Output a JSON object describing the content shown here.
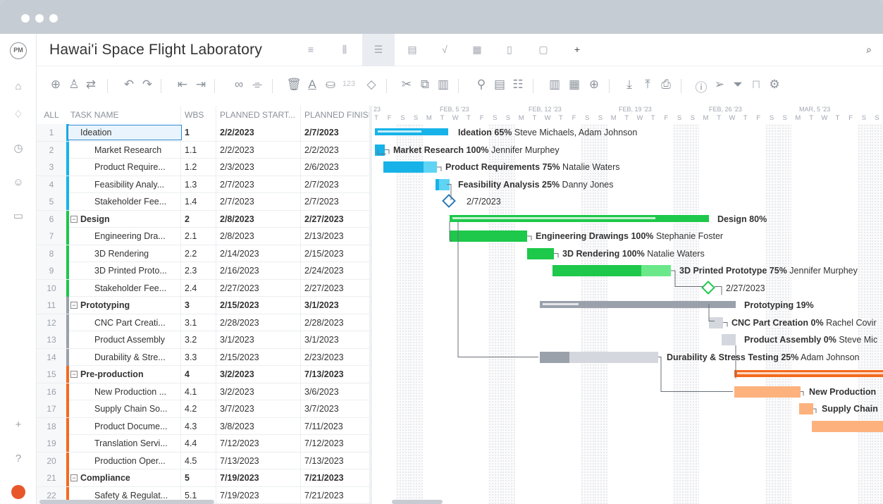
{
  "app": {
    "title": "Hawai'i Space Flight Laboratory",
    "logo_text": "PM"
  },
  "columns": {
    "all": "ALL",
    "task": "TASK NAME",
    "wbs": "WBS",
    "start": "PLANNED START...",
    "finish": "PLANNED FINISI"
  },
  "timeline": {
    "months": [
      "FEB, 5 '23",
      "FEB, 12 '23",
      "FEB, 19 '23",
      "FEB, 26 '23",
      "MAR, 5 '23"
    ],
    "first_month_fragment": "23",
    "days": [
      "T",
      "F",
      "S",
      "S",
      "M",
      "T",
      "W",
      "T",
      "F",
      "S",
      "S",
      "M",
      "T",
      "W",
      "T",
      "F",
      "S",
      "S",
      "M",
      "T",
      "W",
      "T",
      "F",
      "S",
      "S",
      "M",
      "T",
      "W",
      "T",
      "F",
      "S",
      "S",
      "M",
      "T",
      "W",
      "T",
      "F",
      "S",
      "S"
    ]
  },
  "rows": [
    {
      "num": "1",
      "name": "Ideation",
      "wbs": "1",
      "start": "2/2/2023",
      "finish": "2/7/2023",
      "type": "summary-plain",
      "color": "#17b3e8"
    },
    {
      "num": "2",
      "name": "Market Research",
      "wbs": "1.1",
      "start": "2/2/2023",
      "finish": "2/2/2023",
      "type": "task",
      "color": "#17b3e8"
    },
    {
      "num": "3",
      "name": "Product Require...",
      "wbs": "1.2",
      "start": "2/3/2023",
      "finish": "2/6/2023",
      "type": "task",
      "color": "#17b3e8"
    },
    {
      "num": "4",
      "name": "Feasibility Analy...",
      "wbs": "1.3",
      "start": "2/7/2023",
      "finish": "2/7/2023",
      "type": "task",
      "color": "#17b3e8"
    },
    {
      "num": "5",
      "name": "Stakeholder Fee...",
      "wbs": "1.4",
      "start": "2/7/2023",
      "finish": "2/7/2023",
      "type": "task",
      "color": "#17b3e8"
    },
    {
      "num": "6",
      "name": "Design",
      "wbs": "2",
      "start": "2/8/2023",
      "finish": "2/27/2023",
      "type": "summary",
      "color": "#1dc84a"
    },
    {
      "num": "7",
      "name": "Engineering Dra...",
      "wbs": "2.1",
      "start": "2/8/2023",
      "finish": "2/13/2023",
      "type": "task",
      "color": "#1dc84a"
    },
    {
      "num": "8",
      "name": "3D Rendering",
      "wbs": "2.2",
      "start": "2/14/2023",
      "finish": "2/15/2023",
      "type": "task",
      "color": "#1dc84a"
    },
    {
      "num": "9",
      "name": "3D Printed Proto...",
      "wbs": "2.3",
      "start": "2/16/2023",
      "finish": "2/24/2023",
      "type": "task",
      "color": "#1dc84a"
    },
    {
      "num": "10",
      "name": "Stakeholder Fee...",
      "wbs": "2.4",
      "start": "2/27/2023",
      "finish": "2/27/2023",
      "type": "task",
      "color": "#1dc84a"
    },
    {
      "num": "11",
      "name": "Prototyping",
      "wbs": "3",
      "start": "2/15/2023",
      "finish": "3/1/2023",
      "type": "summary",
      "color": "#9aa1ab"
    },
    {
      "num": "12",
      "name": "CNC Part Creati...",
      "wbs": "3.1",
      "start": "2/28/2023",
      "finish": "2/28/2023",
      "type": "task",
      "color": "#9aa1ab"
    },
    {
      "num": "13",
      "name": "Product Assembly",
      "wbs": "3.2",
      "start": "3/1/2023",
      "finish": "3/1/2023",
      "type": "task",
      "color": "#9aa1ab"
    },
    {
      "num": "14",
      "name": "Durability & Stre...",
      "wbs": "3.3",
      "start": "2/15/2023",
      "finish": "2/23/2023",
      "type": "task",
      "color": "#9aa1ab"
    },
    {
      "num": "15",
      "name": "Pre-production",
      "wbs": "4",
      "start": "3/2/2023",
      "finish": "7/13/2023",
      "type": "summary",
      "color": "#f46a1f"
    },
    {
      "num": "16",
      "name": "New Production ...",
      "wbs": "4.1",
      "start": "3/2/2023",
      "finish": "3/6/2023",
      "type": "task",
      "color": "#f46a1f"
    },
    {
      "num": "17",
      "name": "Supply Chain So...",
      "wbs": "4.2",
      "start": "3/7/2023",
      "finish": "3/7/2023",
      "type": "task",
      "color": "#f46a1f"
    },
    {
      "num": "18",
      "name": "Product Docume...",
      "wbs": "4.3",
      "start": "3/8/2023",
      "finish": "7/11/2023",
      "type": "task",
      "color": "#f46a1f"
    },
    {
      "num": "19",
      "name": "Translation Servi...",
      "wbs": "4.4",
      "start": "7/12/2023",
      "finish": "7/12/2023",
      "type": "task",
      "color": "#f46a1f"
    },
    {
      "num": "20",
      "name": "Production Oper...",
      "wbs": "4.5",
      "start": "7/13/2023",
      "finish": "7/13/2023",
      "type": "task",
      "color": "#f46a1f"
    },
    {
      "num": "21",
      "name": "Compliance",
      "wbs": "5",
      "start": "7/19/2023",
      "finish": "7/21/2023",
      "type": "summary",
      "color": "#f46a1f"
    },
    {
      "num": "22",
      "name": "Safety & Regulat...",
      "wbs": "5.1",
      "start": "7/19/2023",
      "finish": "7/21/2023",
      "type": "task",
      "color": "#f46a1f"
    }
  ],
  "gantt_labels": [
    {
      "name": "Ideation",
      "pct": "65%",
      "who": "Steve Michaels, Adam Johnson"
    },
    {
      "name": "Market Research",
      "pct": "100%",
      "who": "Jennifer Murphey"
    },
    {
      "name": "Product Requirements",
      "pct": "75%",
      "who": "Natalie Waters"
    },
    {
      "name": "Feasibility Analysis",
      "pct": "25%",
      "who": "Danny Jones"
    },
    {
      "name": "",
      "pct": "",
      "who": "2/7/2023"
    },
    {
      "name": "Design",
      "pct": "80%",
      "who": ""
    },
    {
      "name": "Engineering Drawings",
      "pct": "100%",
      "who": "Stephanie Foster"
    },
    {
      "name": "3D Rendering",
      "pct": "100%",
      "who": "Natalie Waters"
    },
    {
      "name": "3D Printed Prototype",
      "pct": "75%",
      "who": "Jennifer Murphey"
    },
    {
      "name": "",
      "pct": "",
      "who": "2/27/2023"
    },
    {
      "name": "Prototyping",
      "pct": "19%",
      "who": ""
    },
    {
      "name": "CNC Part Creation",
      "pct": "0%",
      "who": "Rachel Covir"
    },
    {
      "name": "Product Assembly",
      "pct": "0%",
      "who": "Steve Mic"
    },
    {
      "name": "Durability & Stress Testing",
      "pct": "25%",
      "who": "Adam Johnson"
    },
    {
      "name": "",
      "pct": "",
      "who": ""
    },
    {
      "name": "New Production",
      "pct": "",
      "who": ""
    },
    {
      "name": "Supply Chain",
      "pct": "",
      "who": ""
    }
  ],
  "toolbar": {
    "count_label": "123"
  }
}
